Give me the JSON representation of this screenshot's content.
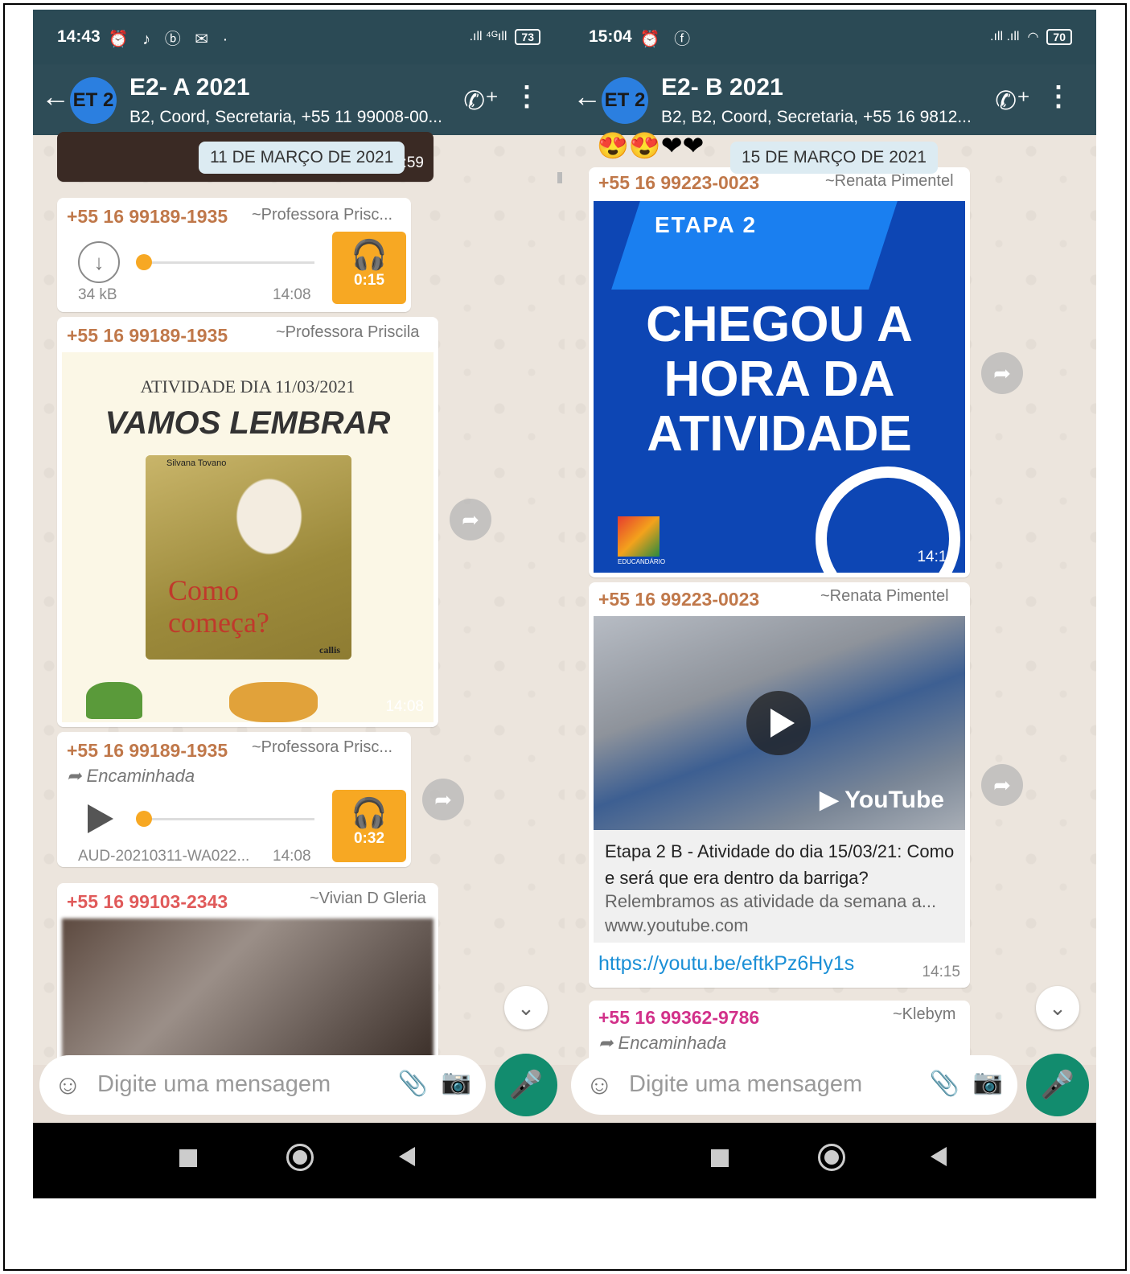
{
  "left": {
    "status": {
      "time": "14:43",
      "icons": "⏰ ♪ ⓑ ✉ ·",
      "signal": ".ıll ⁴ᴳıll",
      "battery": "73"
    },
    "header": {
      "avatar": "ET 2",
      "title": "E2- A 2021",
      "subtitle": "B2, Coord, Secretaria, +55 11 99008-00..."
    },
    "date_pill": "11 DE MARÇO DE 2021",
    "top_time": "3:59",
    "messages": [
      {
        "number": "+55 16 99189-1935",
        "name": "~Professora Prisc...",
        "size": "34 kB",
        "time": "14:08",
        "duration": "0:15"
      },
      {
        "number": "+55 16 99189-1935",
        "name": "~Professora Priscila",
        "img_line1": "ATIVIDADE DIA 11/03/2021",
        "img_line2": "VAMOS LEMBRAR",
        "book_author": "Silvana Tovano",
        "book_title": "Como começa?",
        "book_publisher": "callis",
        "time": "14:08"
      },
      {
        "number": "+55 16 99189-1935",
        "name": "~Professora Prisc...",
        "forwarded": "Encaminhada",
        "filename": "AUD-20210311-WA022...",
        "time": "14:08",
        "duration": "0:32"
      },
      {
        "number": "+55 16 99103-2343",
        "name": "~Vivian D Gleria"
      }
    ],
    "input_placeholder": "Digite uma mensagem"
  },
  "right": {
    "status": {
      "time": "15:04",
      "icons": "⏰ ⓕ",
      "signal": ".ıll .ıll",
      "battery": "70"
    },
    "header": {
      "avatar": "ET 2",
      "title": "E2- B 2021",
      "subtitle": "B2, B2, Coord, Secretaria, +55 16 9812..."
    },
    "date_pill": "15 DE MARÇO DE 2021",
    "messages": [
      {
        "number": "+55 16 99223-0023",
        "name": "~Renata Pimentel",
        "img_tag": "ETAPA 2",
        "img_l1": "CHEGOU A",
        "img_l2": "HORA DA",
        "img_l3": "ATIVIDADE",
        "img_logo": "EDUCANDÁRIO",
        "time": "14:15"
      },
      {
        "number": "+55 16 99223-0023",
        "name": "~Renata Pimentel",
        "yt_brand": "YouTube",
        "preview_title": "Etapa 2 B - Atividade do dia 15/03/21: Como e será que era dentro da barriga?",
        "preview_desc": "Relembramos as atividade da semana a...",
        "preview_domain": "www.youtube.com",
        "link": "https://youtu.be/eftkPz6Hy1s",
        "time": "14:15"
      },
      {
        "number": "+55 16 99362-9786",
        "name": "~Klebym",
        "forwarded": "Encaminhada"
      }
    ],
    "input_placeholder": "Digite uma mensagem"
  },
  "colors": {
    "header": "#2e4c57",
    "mic": "#128c6e",
    "audio_tile": "#f7a823",
    "link": "#1a8fd6"
  }
}
